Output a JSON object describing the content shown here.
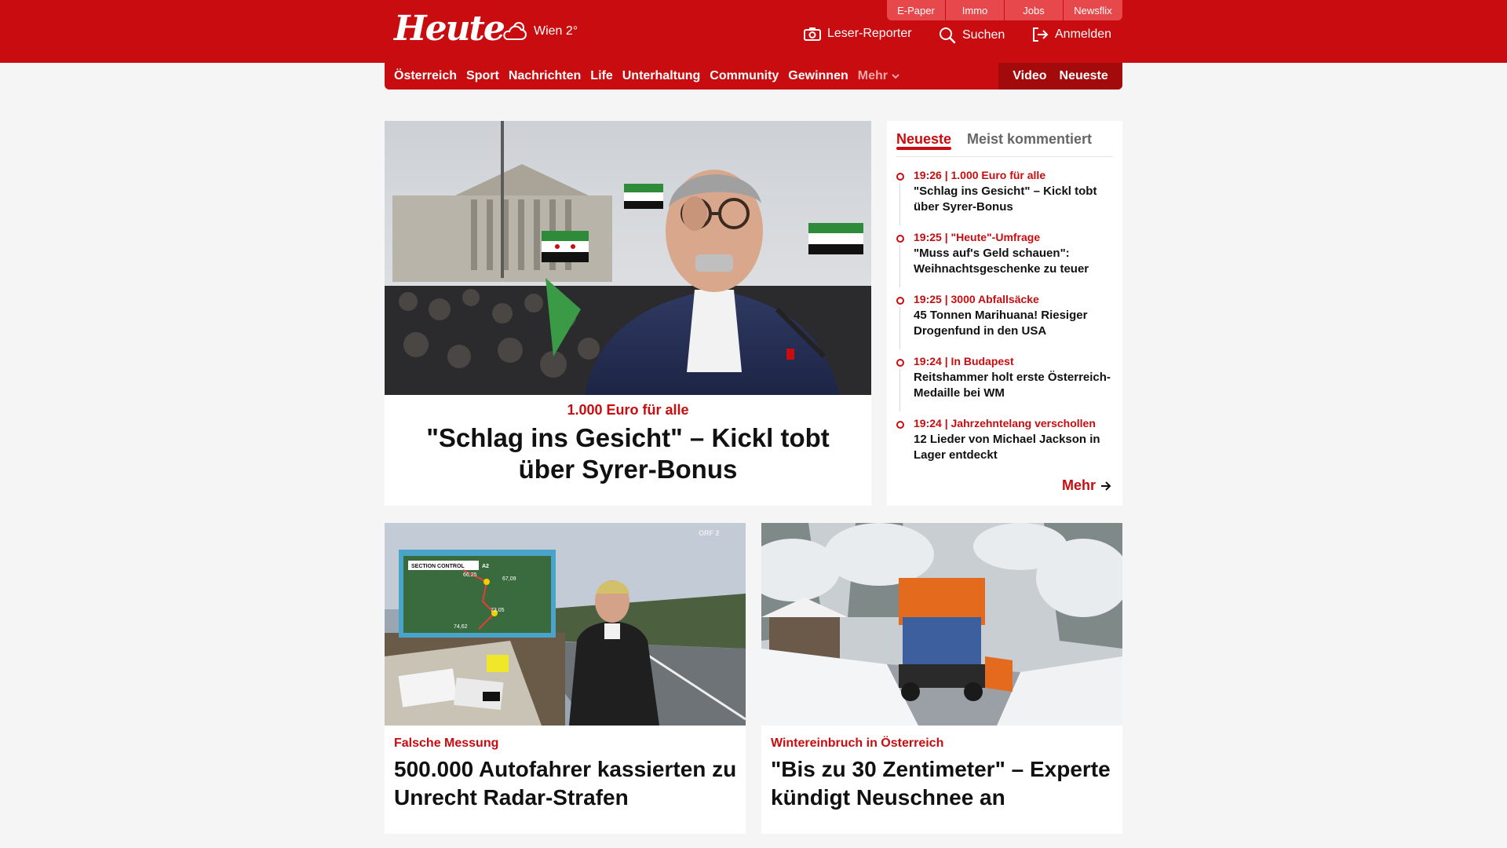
{
  "brand": {
    "logo": "Heute",
    "accent": "#c90c0f",
    "dark_accent": "#a20a0c"
  },
  "weather": {
    "icon": "cloud-sun-icon",
    "label": "Wien 2°"
  },
  "utility_tabs": [
    "E-Paper",
    "Immo",
    "Jobs",
    "Newsflix"
  ],
  "header_actions": {
    "reporter": {
      "icon": "camera-icon",
      "label": "Leser-Reporter"
    },
    "search": {
      "icon": "search-icon",
      "label": "Suchen"
    },
    "login": {
      "icon": "login-icon",
      "label": "Anmelden"
    }
  },
  "nav": {
    "items": [
      "Österreich",
      "Sport",
      "Nachrichten",
      "Life",
      "Unterhaltung",
      "Community",
      "Gewinnen"
    ],
    "more_label": "Mehr",
    "right": [
      "Video",
      "Neueste"
    ]
  },
  "hero": {
    "kicker": "1.000 Euro für alle",
    "title": "\"Schlag ins Gesicht\" – Kickl tobt über Syrer-Bonus"
  },
  "sidebar": {
    "tabs": [
      "Neueste",
      "Meist kommentiert"
    ],
    "items": [
      {
        "meta": "19:26 | 1.000 Euro für alle",
        "headline": "\"Schlag ins Gesicht\" – Kickl tobt über Syrer-Bonus"
      },
      {
        "meta": "19:25 | \"Heute\"-Umfrage",
        "headline": "\"Muss auf's Geld schauen\": Weihnachtsgeschenke zu teuer"
      },
      {
        "meta": "19:25 | 3000 Abfallsäcke",
        "headline": "45 Tonnen Marihuana! Riesiger Drogenfund in den USA"
      },
      {
        "meta": "19:24 | In Budapest",
        "headline": "Reitshammer holt erste Österreich-Medaille bei WM"
      },
      {
        "meta": "19:24 | Jahrzehntelang verschollen",
        "headline": "12 Lieder von Michael Jackson in Lager entdeckt"
      }
    ],
    "more_label": "Mehr"
  },
  "cards": [
    {
      "kicker": "Falsche Messung",
      "title": "500.000 Autofahrer kassierten zu Unrecht Radar-Strafen",
      "overlay": {
        "title": "SECTION CONTROL",
        "road": "A2",
        "km": [
          "66,25",
          "67,09",
          "73,05",
          "74,62"
        ],
        "channel": "ORF 2"
      }
    },
    {
      "kicker": "Wintereinbruch in Österreich",
      "title": "\"Bis zu 30 Zentimeter\" – Experte kündigt Neuschnee an"
    }
  ]
}
